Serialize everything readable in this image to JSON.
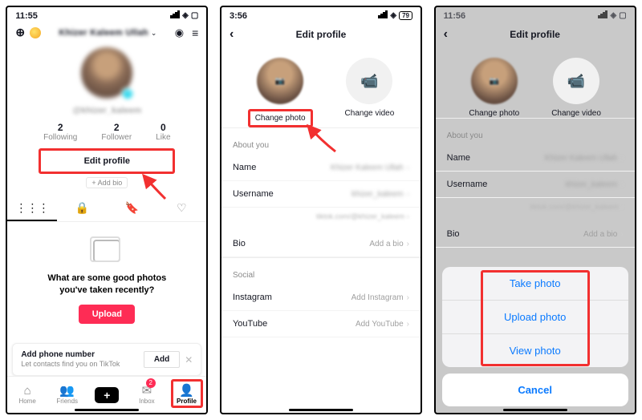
{
  "screen1": {
    "time": "11:55",
    "user_display_name": "Khizer Kaleem Ullah",
    "handle": "@khizer_kaleem",
    "stats": {
      "following": {
        "count": "2",
        "label": "Following"
      },
      "follower": {
        "count": "2",
        "label": "Follower"
      },
      "like": {
        "count": "0",
        "label": "Like"
      }
    },
    "edit_profile_label": "Edit profile",
    "add_bio_label": "+ Add bio",
    "empty": {
      "line1": "What are some good photos",
      "line2": "you've taken recently?",
      "upload_label": "Upload"
    },
    "phone_prompt": {
      "title": "Add phone number",
      "subtitle": "Let contacts find you on TikTok",
      "add_label": "Add"
    },
    "bottom_tabs": {
      "home": "Home",
      "friends": "Friends",
      "inbox": "Inbox",
      "inbox_badge": "2",
      "profile": "Profile"
    }
  },
  "screen2": {
    "time": "3:56",
    "battery": "79",
    "title": "Edit profile",
    "change_photo": "Change photo",
    "change_video": "Change video",
    "sections": {
      "about": "About you",
      "social": "Social"
    },
    "rows": {
      "name": {
        "label": "Name",
        "value": "Khizer Kaleem Ullah"
      },
      "username": {
        "label": "Username",
        "value": "khizer_kaleem"
      },
      "link": "tiktok.com/@khizer_kaleem",
      "bio": {
        "label": "Bio",
        "value": "Add a bio"
      },
      "instagram": {
        "label": "Instagram",
        "value": "Add Instagram"
      },
      "youtube": {
        "label": "YouTube",
        "value": "Add YouTube"
      }
    }
  },
  "screen3": {
    "time": "11:56",
    "title": "Edit profile",
    "change_photo": "Change photo",
    "change_video": "Change video",
    "sections": {
      "about": "About you"
    },
    "rows": {
      "name": {
        "label": "Name",
        "value": "Khizer Kaleem Ullah"
      },
      "username": {
        "label": "Username",
        "value": "khizer_kaleem"
      },
      "link": "tiktok.com/@khizer_kaleem",
      "bio": {
        "label": "Bio",
        "value": "Add a bio"
      }
    },
    "sheet": {
      "take": "Take photo",
      "upload": "Upload photo",
      "view": "View photo",
      "cancel": "Cancel"
    }
  }
}
